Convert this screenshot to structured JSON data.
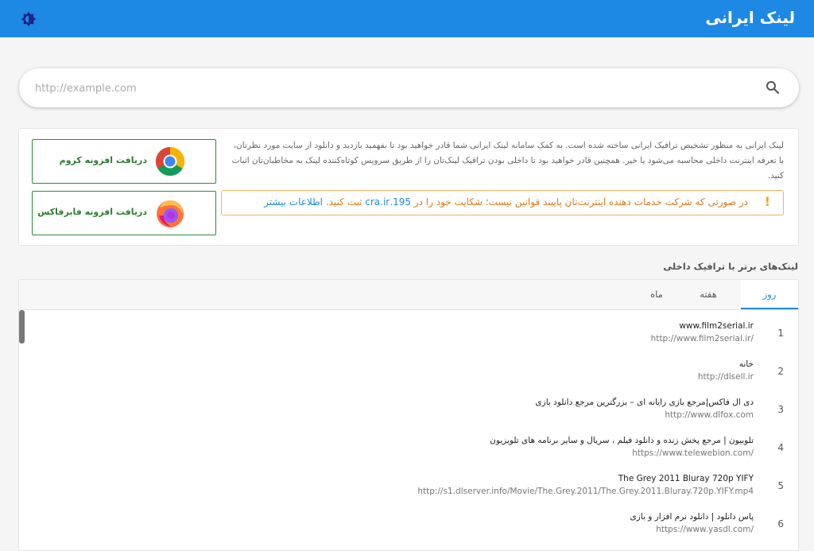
{
  "header": {
    "title": "لینک ایرانی",
    "theme_icon": "brightness-icon",
    "color": "#1e88e5"
  },
  "search": {
    "placeholder": "http://example.com",
    "value": "",
    "icon": "search-icon"
  },
  "info": {
    "intro": "لینک ایرانی به منظور تشخیص ترافیک ایرانی ساخته شده است. به کمک سامانه لینک ایرانی شما قادر خواهید بود تا بفهمید بازدید و دانلود از سایت مورد نظرتان، با تعرفه اینترنت داخلی محاسبه می‌شود یا خیر. همچنین قادر خواهید بود تا داخلی بودن ترافیک لینک‌تان را از طریق سرویس کوتاه‌کننده لینک به مخاطبان‌تان اثبات کنید.",
    "warning": {
      "mark": "!",
      "text_before": "در صورتی که شرکت خدمات دهنده اینترنت‌تان پایبند قوانین نیست؛ شکایت خود را در ",
      "site": "195.cra.ir",
      "text_after": " ثبت کنید. ",
      "more": "اطلاعات بیشتر"
    },
    "chrome_label": "دریافت افزونه کروم",
    "firefox_label": "دریافت افزونه فایرفاکس"
  },
  "top_links": {
    "title": "لینک‌های برتر با ترافیک داخلی",
    "tabs": {
      "day": "روز",
      "week": "هفته",
      "month": "ماه"
    },
    "active_tab": "day",
    "rows": [
      {
        "rank": "1",
        "title": "www.film2serial.ir",
        "url": "http://www.film2serial.ir/"
      },
      {
        "rank": "2",
        "title": "خانه",
        "url": "http://dlsell.ir"
      },
      {
        "rank": "3",
        "title": "دی ال فاکس|مرجع بازی رایانه ای – بزرگترین مرجع دانلود بازی",
        "url": "http://www.dlfox.com"
      },
      {
        "rank": "4",
        "title": "تلوبیون | مرجع پخش زنده و دانلود فیلم ، سریال و سایر برنامه های تلویزیون",
        "url": "https://www.telewebion.com/"
      },
      {
        "rank": "5",
        "title": "The Grey 2011 Bluray 720p YIFY",
        "url": "http://s1.dlserver.info/Movie/The.Grey.2011/The.Grey.2011.Bluray.720p.YIFY.mp4"
      },
      {
        "rank": "6",
        "title": "پاس دانلود | دانلود نرم افزار و بازی",
        "url": "https://www.yasdl.com/"
      }
    ]
  }
}
